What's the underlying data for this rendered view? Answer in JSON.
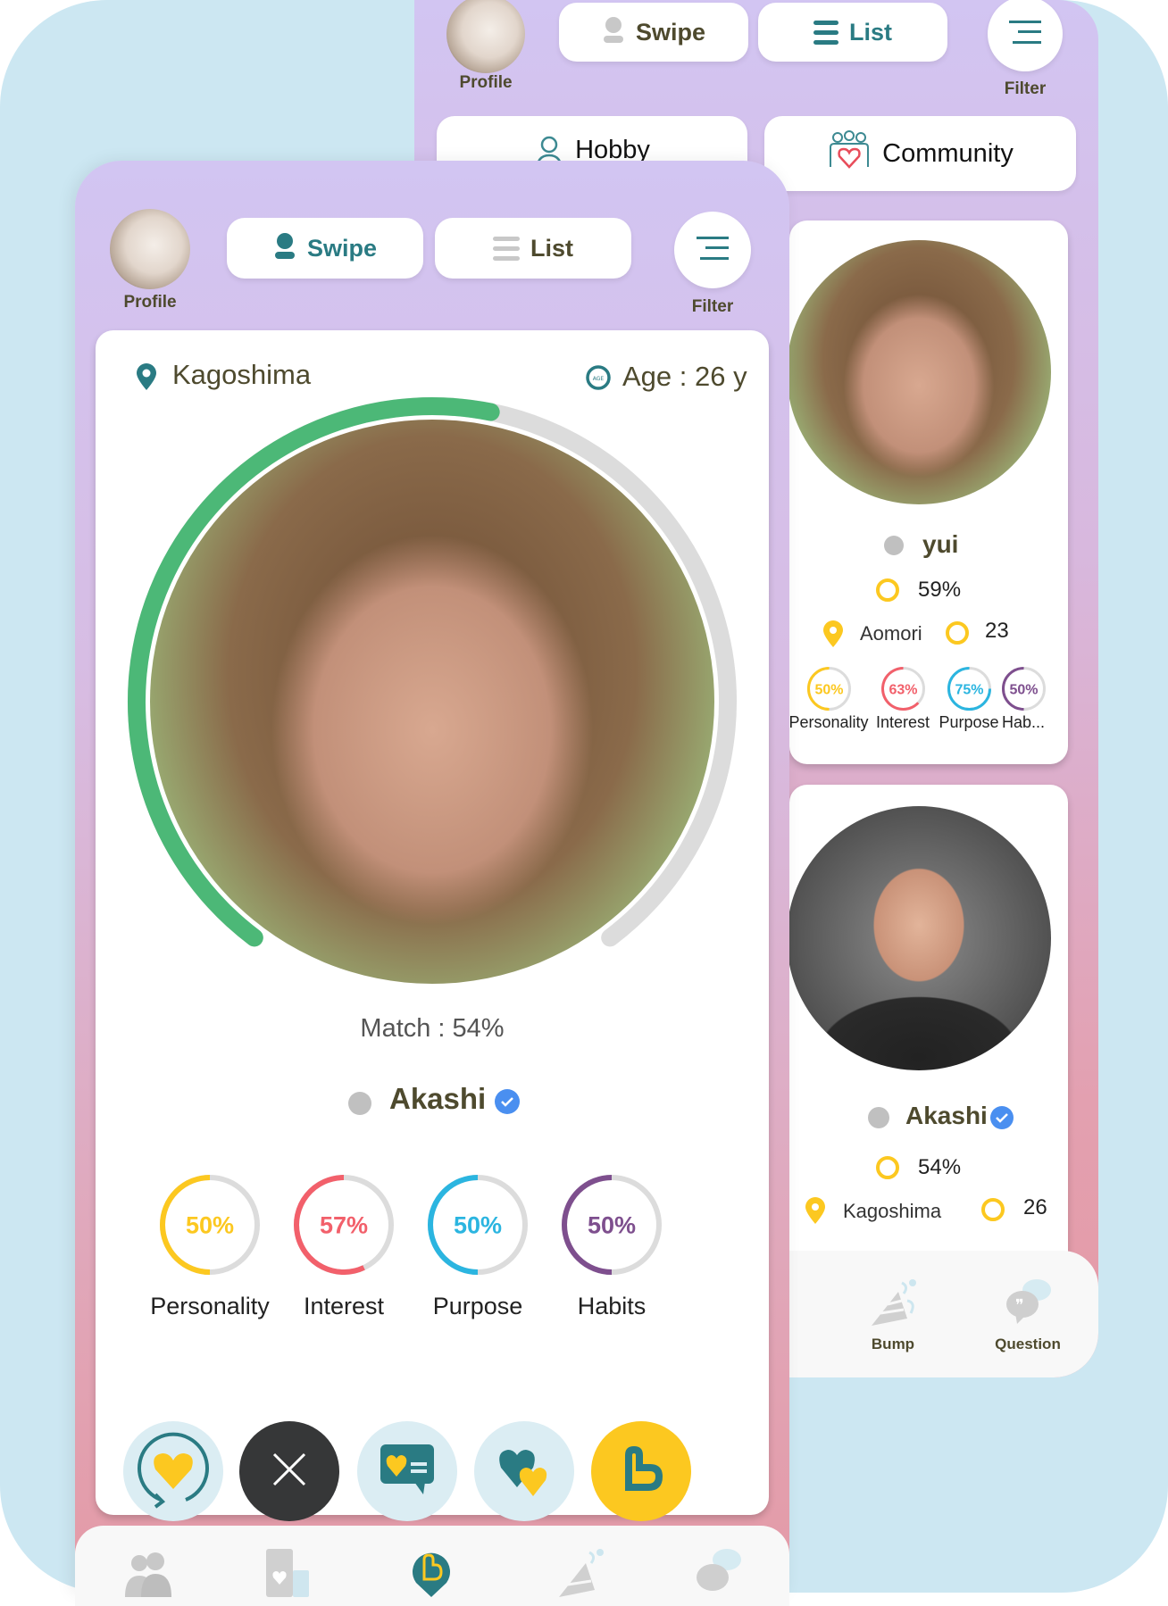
{
  "colors": {
    "teal": "#2a7b83",
    "yellow": "#fcc820",
    "red": "#f2606b",
    "blue": "#2bb5e0",
    "purple": "#7e4f8e",
    "green": "#4cb877",
    "track": "#dcdcdc",
    "text_olive": "#4e4a2e"
  },
  "back_screen": {
    "header": {
      "profile_label": "Profile",
      "swipe_label": "Swipe",
      "list_label": "List",
      "filter_label": "Filter"
    },
    "tabs": [
      {
        "label": "Hobby",
        "icon": "person-heart-icon"
      },
      {
        "label": "Community",
        "icon": "group-heart-icon"
      }
    ],
    "cards": [
      {
        "name": "yui",
        "online": false,
        "match": "59%",
        "match_value": 59,
        "location": "Aomori",
        "age": "23",
        "scores": [
          {
            "label": "Personality",
            "text": "50%",
            "value": 50,
            "color": "#fcc820"
          },
          {
            "label": "Interest",
            "text": "63%",
            "value": 63,
            "color": "#f2606b"
          },
          {
            "label": "Purpose",
            "text": "75%",
            "value": 75,
            "color": "#2bb5e0"
          },
          {
            "label": "Hab...",
            "text": "50%",
            "value": 50,
            "color": "#7e4f8e"
          }
        ]
      },
      {
        "name": "Akashi",
        "verified": true,
        "online": false,
        "match": "54%",
        "match_value": 54,
        "location": "Kagoshima",
        "age": "26"
      }
    ],
    "bottom_nav": [
      {
        "label": "Bump",
        "icon": "party-popper-icon"
      },
      {
        "label": "Question",
        "icon": "chat-bubbles-icon"
      }
    ]
  },
  "front_screen": {
    "header": {
      "profile_label": "Profile",
      "swipe_label": "Swipe",
      "list_label": "List",
      "filter_label": "Filter"
    },
    "location": "Kagoshima",
    "age": "Age : 26 y",
    "match_text": "Match : 54%",
    "match_value": 54,
    "name": "Akashi",
    "verified": true,
    "scores": [
      {
        "label": "Personality",
        "text": "50%",
        "value": 50,
        "color": "#fcc820"
      },
      {
        "label": "Interest",
        "text": "57%",
        "value": 57,
        "color": "#f2606b"
      },
      {
        "label": "Purpose",
        "text": "50%",
        "value": 50,
        "color": "#2bb5e0"
      },
      {
        "label": "Habits",
        "text": "50%",
        "value": 50,
        "color": "#7e4f8e"
      }
    ],
    "actions": [
      {
        "name": "rewind-like",
        "icon": "heart-refresh-icon"
      },
      {
        "name": "dislike",
        "icon": "close-icon"
      },
      {
        "name": "message-like",
        "icon": "heart-message-icon"
      },
      {
        "name": "super-like",
        "icon": "double-heart-icon"
      },
      {
        "name": "boost",
        "icon": "app-logo-icon"
      }
    ],
    "bottom_nav": [
      {
        "icon": "couple-icon"
      },
      {
        "icon": "cards-icon"
      },
      {
        "icon": "app-logo-icon"
      },
      {
        "icon": "party-popper-icon"
      },
      {
        "icon": "chat-bubbles-icon"
      }
    ]
  }
}
